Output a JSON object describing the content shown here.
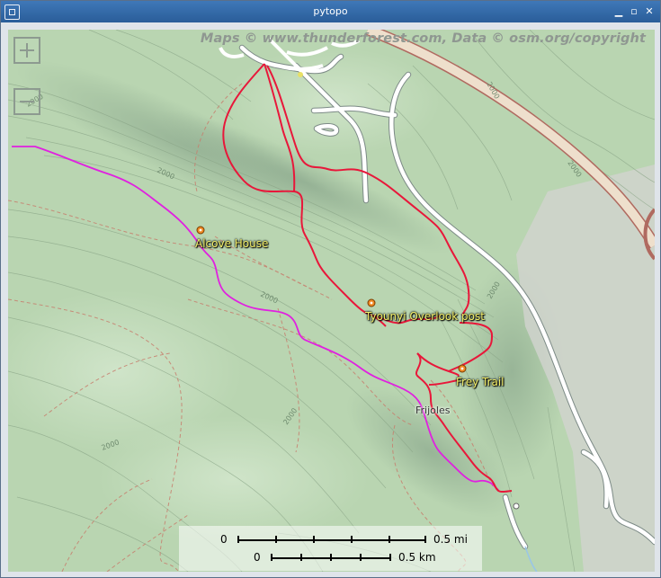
{
  "window": {
    "title": "pytopo"
  },
  "controls": {
    "minimize": "▁",
    "maximize": "▫",
    "close": "✕"
  },
  "map": {
    "attribution": "Maps © www.thunderforest.com, Data © osm.org/copyright",
    "zoom_in": "+",
    "zoom_out": "−",
    "colors": {
      "track": "#e8173a",
      "track_alt": "#e020e0",
      "road": "#ffffff",
      "highway": "#e8d8c4",
      "terrain": "#b8d4b0"
    },
    "waypoints": [
      {
        "label": "Alcove House"
      },
      {
        "label": "Tyounyi Overlook post"
      },
      {
        "label": "Frey Trail"
      }
    ],
    "places": [
      {
        "label": "Frijoles"
      }
    ],
    "contour_labels": [
      "2000",
      "2000",
      "2000",
      "2000",
      "2000",
      "2000",
      "2000",
      "2000"
    ],
    "scale": {
      "zero": "0",
      "mi_label": "0.5 mi",
      "km_label": "0.5 km"
    }
  }
}
